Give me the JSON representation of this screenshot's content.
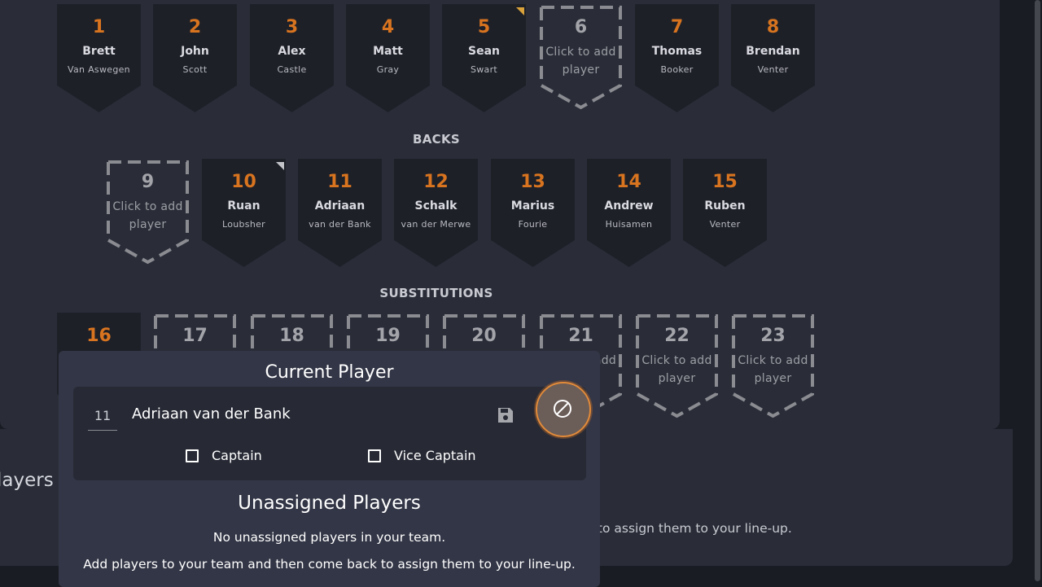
{
  "sections": {
    "backs": "BACKS",
    "substitutions": "SUBSTITUTIONS"
  },
  "forwards": [
    {
      "number": "1",
      "first": "Brett",
      "last": "Van Aswegen",
      "empty": false,
      "marker": ""
    },
    {
      "number": "2",
      "first": "John",
      "last": "Scott",
      "empty": false,
      "marker": ""
    },
    {
      "number": "3",
      "first": "Alex",
      "last": "Castle",
      "empty": false,
      "marker": ""
    },
    {
      "number": "4",
      "first": "Matt",
      "last": "Gray",
      "empty": false,
      "marker": ""
    },
    {
      "number": "5",
      "first": "Sean",
      "last": "Swart",
      "empty": false,
      "marker": "vice-captain"
    },
    {
      "number": "6",
      "empty": true,
      "add_line1": "Click to add",
      "add_line2": "player"
    },
    {
      "number": "7",
      "first": "Thomas",
      "last": "Booker",
      "empty": false,
      "marker": ""
    },
    {
      "number": "8",
      "first": "Brendan",
      "last": "Venter",
      "empty": false,
      "marker": ""
    }
  ],
  "backs": [
    {
      "number": "9",
      "empty": true,
      "add_line1": "Click to add",
      "add_line2": "player"
    },
    {
      "number": "10",
      "first": "Ruan",
      "last": "Loubsher",
      "empty": false,
      "marker": "captain"
    },
    {
      "number": "11",
      "first": "Adriaan",
      "last": "van der Bank",
      "empty": false,
      "marker": ""
    },
    {
      "number": "12",
      "first": "Schalk",
      "last": "van der Merwe",
      "empty": false,
      "marker": ""
    },
    {
      "number": "13",
      "first": "Marius",
      "last": "Fourie",
      "empty": false,
      "marker": ""
    },
    {
      "number": "14",
      "first": "Andrew",
      "last": "Huisamen",
      "empty": false,
      "marker": ""
    },
    {
      "number": "15",
      "first": "Ruben",
      "last": "Venter",
      "empty": false,
      "marker": ""
    }
  ],
  "substitutions": [
    {
      "number": "16",
      "empty": false
    },
    {
      "number": "17",
      "empty": true
    },
    {
      "number": "18",
      "empty": true
    },
    {
      "number": "19",
      "empty": true
    },
    {
      "number": "20",
      "empty": true
    },
    {
      "number": "21",
      "empty": true,
      "add_line1": "add"
    },
    {
      "number": "22",
      "empty": true,
      "add_line1": "Click to add",
      "add_line2": "player"
    },
    {
      "number": "23",
      "empty": true,
      "add_line1": "Click to add",
      "add_line2": "player"
    }
  ],
  "popover": {
    "title": "Current Player",
    "player_number": "11",
    "player_name": "Adriaan van der Bank",
    "captain_label": "Captain",
    "vice_captain_label": "Vice Captain",
    "unassigned_title": "Unassigned Players",
    "unassigned_text1": "No unassigned players in your team.",
    "unassigned_text2": "Add players to your team and then come back to assign them to your line-up."
  },
  "background": {
    "heading_fragment": "layers",
    "text_fragment": "k to assign them to your line-up."
  },
  "colors": {
    "accent": "#d8741f",
    "card": "#1e2028",
    "panel": "#2a2d38",
    "popover": "#333646"
  }
}
